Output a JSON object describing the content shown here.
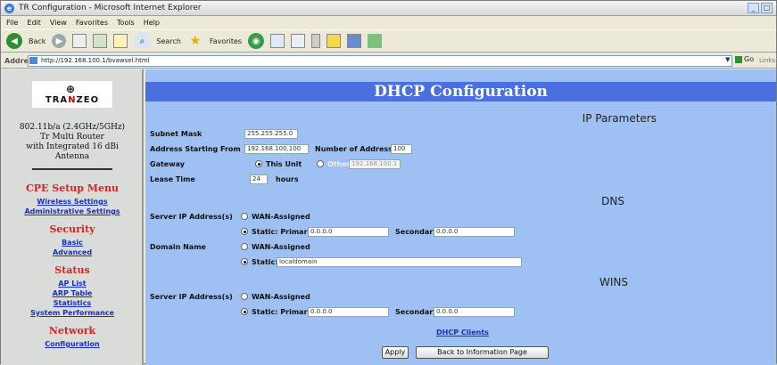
{
  "window": {
    "title": "TR Configuration - Microsoft Internet Explorer",
    "controls": [
      "_",
      "□",
      "×"
    ]
  },
  "menu": [
    "File",
    "Edit",
    "View",
    "Favorites",
    "Tools",
    "Help"
  ],
  "toolbar": {
    "back": "Back",
    "search": "Search",
    "favorites": "Favorites"
  },
  "address": {
    "label": "Address",
    "url": "http://192.168.100.1/bvawsel.html",
    "go": "Go",
    "links": "Links"
  },
  "sidebar": {
    "logo_mark": "⊕",
    "logo_word_1": "TRA",
    "logo_word_red": "N",
    "logo_word_2": "ZEO",
    "desc_1": "802.11b/a (2.4GHz/5GHz)",
    "desc_2": "Tr Multi Router",
    "desc_3": "with Integrated 16 dBi",
    "desc_4": "Antenna",
    "menu_head": "CPE Setup Menu",
    "wireless": "Wireless Settings",
    "admin": "Administrative Settings",
    "security_head": "Security",
    "basic": "Basic",
    "advanced": "Advanced",
    "status_head": "Status",
    "aplist": "AP List",
    "arp": "ARP Table",
    "stats": "Statistics",
    "perf": "System Performance",
    "network_head": "Network",
    "config": "Configuration"
  },
  "main": {
    "title": "DHCP Configuration",
    "ip_params": "IP Parameters",
    "subnet_label": "Subnet Mask",
    "subnet_value": "255.255.255.0",
    "addr_start_label": "Address Starting From",
    "addr_start_value": "192.168.100.100",
    "num_addr_label": "Number of Addresses",
    "num_addr_value": "100",
    "gateway_label": "Gateway",
    "this_unit": "This Unit",
    "other": "Other:",
    "other_value": "192.168.100.1",
    "lease_label": "Lease Time",
    "lease_value": "24",
    "hours": "hours",
    "dns": "DNS",
    "server_ip_label": "Server IP Address(s)",
    "wan_assigned": "WAN-Assigned",
    "static_primary": "Static: Primary",
    "dns_primary": "0.0.0.0",
    "secondary": "Secondary",
    "dns_secondary": "0.0.0.0",
    "domain_label": "Domain Name",
    "static": "Static:",
    "domain_value": "localdomain",
    "wins": "WINS",
    "wins_primary": "0.0.0.0",
    "wins_secondary": "0.0.0.0",
    "dhcp_clients": "DHCP Clients",
    "apply": "Apply",
    "back_info": "Back to Information Page"
  }
}
